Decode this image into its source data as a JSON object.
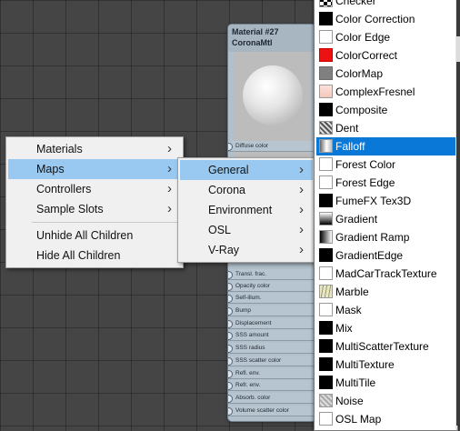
{
  "node": {
    "title": "Material #27",
    "subtitle": "CoronaMtl",
    "slots": [
      "Diffuse color",
      "Transl. frac.",
      "Opacity color",
      "Self-illum.",
      "Bump",
      "Displacement",
      "SSS amount",
      "SSS radius",
      "SSS scatter color",
      "Refl. env.",
      "Refr. env.",
      "Absorb. color",
      "Volume scatter color"
    ]
  },
  "menu_main": {
    "items": [
      {
        "label": "Materials",
        "submenu": true
      },
      {
        "label": "Maps",
        "submenu": true
      },
      {
        "label": "Controllers",
        "submenu": true
      },
      {
        "label": "Sample Slots",
        "submenu": true
      },
      {
        "label": "Unhide All Children",
        "submenu": false
      },
      {
        "label": "Hide All Children",
        "submenu": false
      }
    ]
  },
  "menu_maps": {
    "items": [
      {
        "label": "General"
      },
      {
        "label": "Corona"
      },
      {
        "label": "Environment"
      },
      {
        "label": "OSL"
      },
      {
        "label": "V-Ray"
      }
    ]
  },
  "map_list": {
    "selected": "Falloff",
    "items": [
      {
        "label": "Checker",
        "swatch": "checker"
      },
      {
        "label": "Color Correction",
        "swatch": "black"
      },
      {
        "label": "Color Edge",
        "swatch": "white"
      },
      {
        "label": "ColorCorrect",
        "swatch": "red"
      },
      {
        "label": "ColorMap",
        "swatch": "gray"
      },
      {
        "label": "ComplexFresnel",
        "swatch": "pink"
      },
      {
        "label": "Composite",
        "swatch": "black"
      },
      {
        "label": "Dent",
        "swatch": "noise"
      },
      {
        "label": "Falloff",
        "swatch": "falloff"
      },
      {
        "label": "Forest Color",
        "swatch": "white"
      },
      {
        "label": "Forest Edge",
        "swatch": "white"
      },
      {
        "label": "FumeFX Tex3D",
        "swatch": "black"
      },
      {
        "label": "Gradient",
        "swatch": "gradient"
      },
      {
        "label": "Gradient Ramp",
        "swatch": "gradient-ramp"
      },
      {
        "label": "GradientEdge",
        "swatch": "black"
      },
      {
        "label": "MadCarTrackTexture",
        "swatch": "white"
      },
      {
        "label": "Marble",
        "swatch": "marble"
      },
      {
        "label": "Mask",
        "swatch": "white"
      },
      {
        "label": "Mix",
        "swatch": "black"
      },
      {
        "label": "MultiScatterTexture",
        "swatch": "black"
      },
      {
        "label": "MultiTexture",
        "swatch": "black"
      },
      {
        "label": "MultiTile",
        "swatch": "black"
      },
      {
        "label": "Noise",
        "swatch": "noise-light"
      },
      {
        "label": "OSL Map",
        "swatch": "white"
      }
    ]
  },
  "icons": {
    "submenu_arrow": "chevron-right-icon",
    "slot_socket": "socket-dot-icon"
  },
  "colors": {
    "selection": "#0a78d7",
    "menu_highlight": "#99c9f0",
    "node_body": "#b2c0cb"
  }
}
